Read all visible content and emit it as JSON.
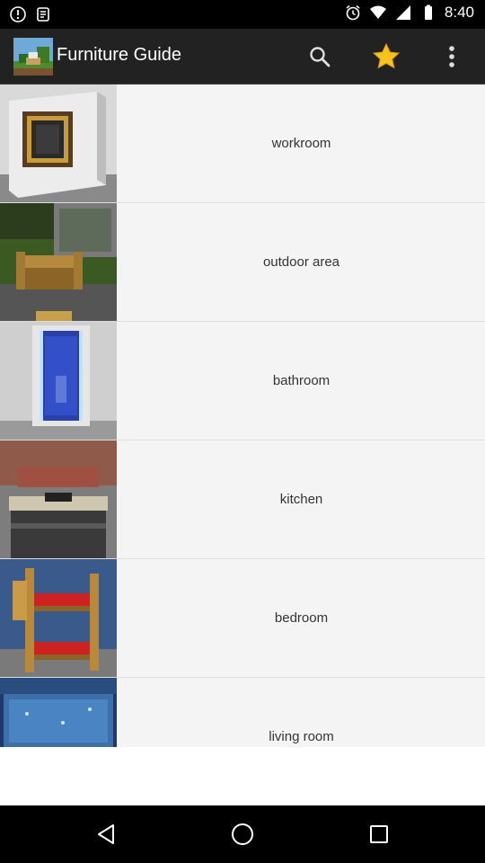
{
  "status_bar": {
    "time": "8:40",
    "left_icons": [
      "notification-icon",
      "notification-icon"
    ],
    "right_icons": [
      "alarm-icon",
      "wifi-icon",
      "signal-icon",
      "battery-icon"
    ]
  },
  "app_bar": {
    "title": "Furniture Guide",
    "actions": [
      "search-icon",
      "star-icon",
      "more-vert-icon"
    ],
    "colors": {
      "background": "#222222",
      "star": "#f6c21c"
    }
  },
  "categories": [
    {
      "label": "workroom",
      "thumbnail": "workroom-thumbnail"
    },
    {
      "label": "outdoor area",
      "thumbnail": "outdoor-area-thumbnail"
    },
    {
      "label": "bathroom",
      "thumbnail": "bathroom-thumbnail"
    },
    {
      "label": "kitchen",
      "thumbnail": "kitchen-thumbnail"
    },
    {
      "label": "bedroom",
      "thumbnail": "bedroom-thumbnail"
    },
    {
      "label": "living room",
      "thumbnail": "living-room-thumbnail"
    }
  ],
  "nav_bar": {
    "buttons": [
      "back-icon",
      "home-icon",
      "recents-icon"
    ]
  }
}
